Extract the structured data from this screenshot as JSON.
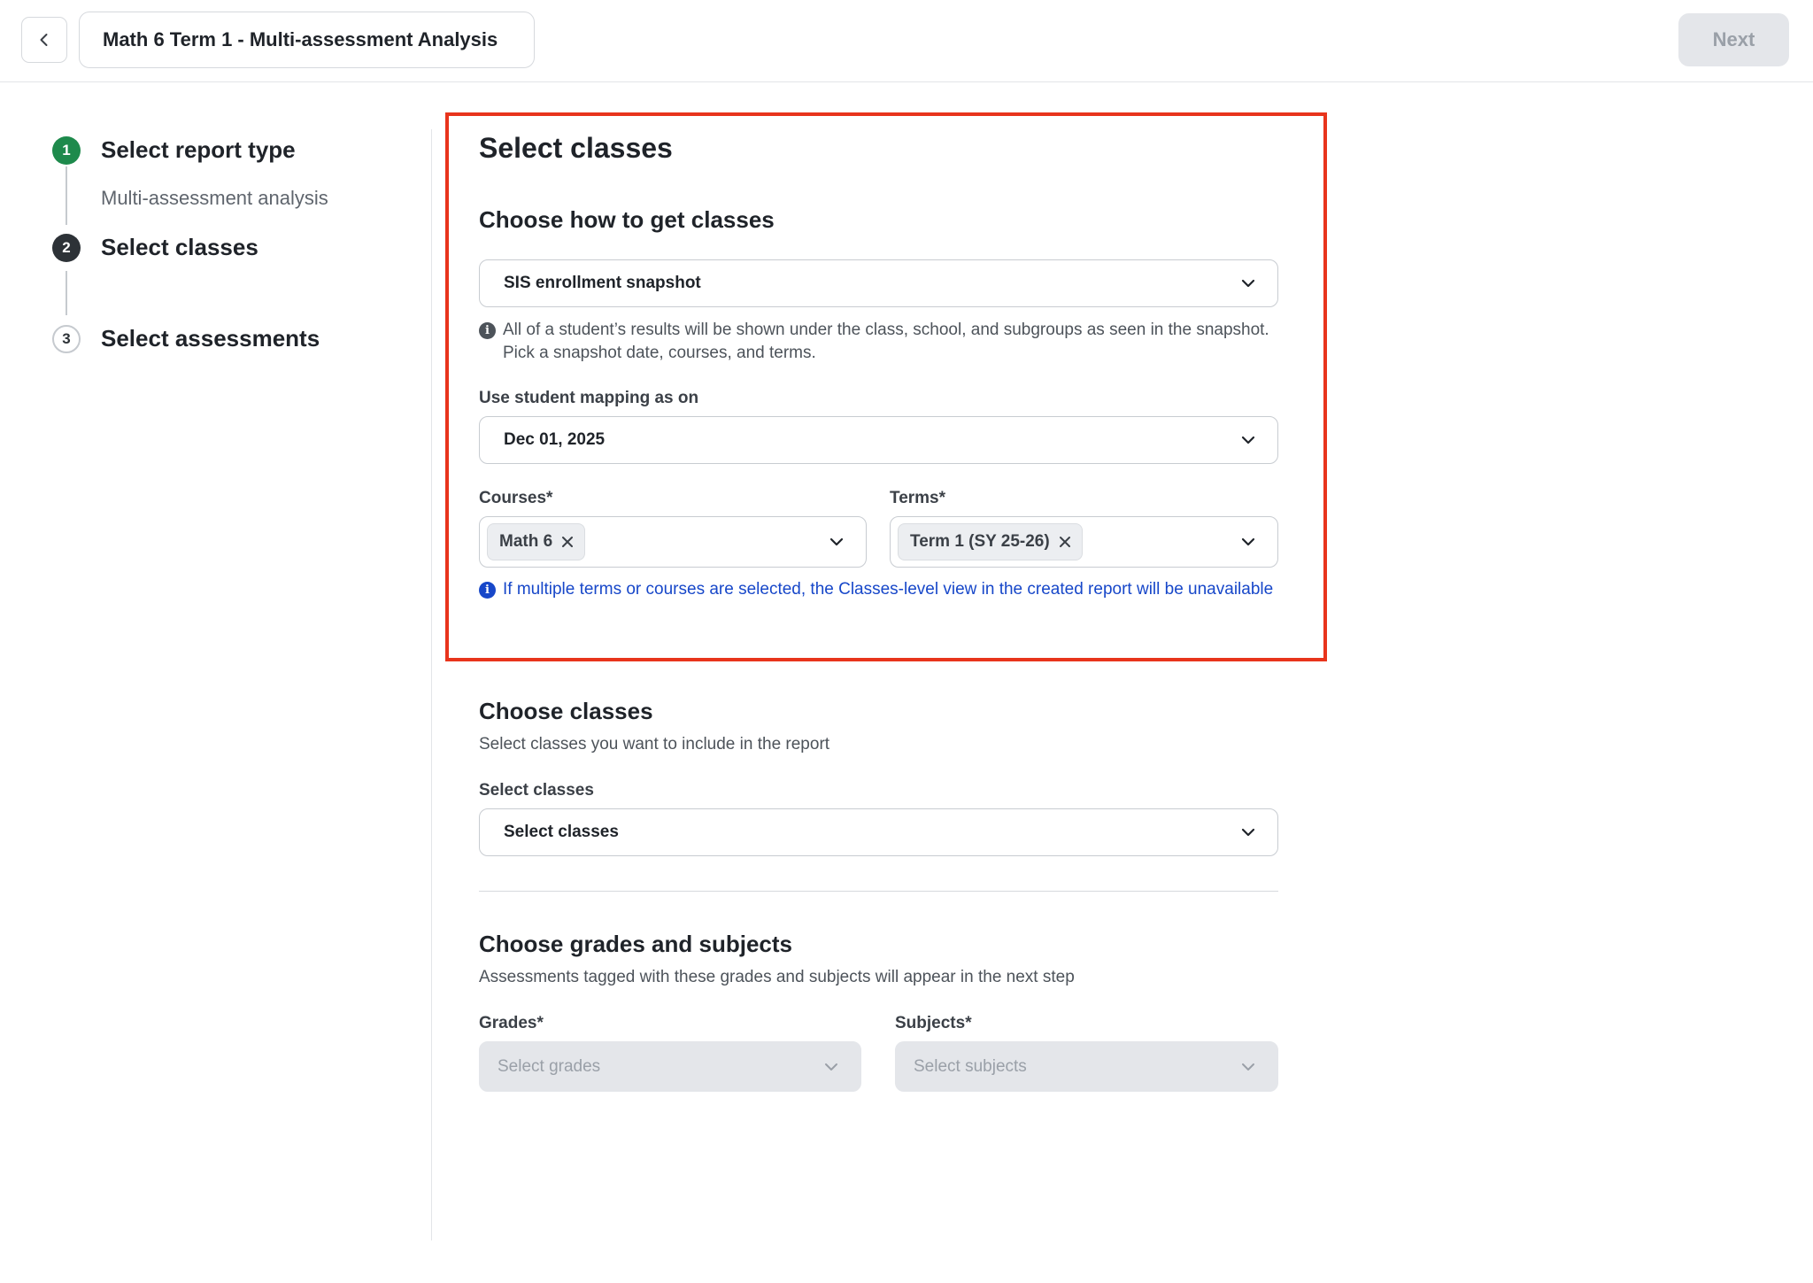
{
  "header": {
    "title": "Math 6 Term 1 - Multi-assessment Analysis",
    "next_label": "Next"
  },
  "stepper": {
    "steps": [
      {
        "number": "1",
        "label": "Select report type",
        "sublabel": "Multi-assessment analysis",
        "status": "done"
      },
      {
        "number": "2",
        "label": "Select classes",
        "sublabel": "",
        "status": "active"
      },
      {
        "number": "3",
        "label": "Select assessments",
        "sublabel": "",
        "status": "todo"
      }
    ]
  },
  "select_classes": {
    "title": "Select classes",
    "how_title": "Choose how to get classes",
    "source_value": "SIS enrollment snapshot",
    "source_info": "All of a student’s results will be shown under the class, school, and subgroups as seen in the snapshot. Pick a snapshot date, courses, and terms.",
    "mapping_label": "Use student mapping as on",
    "mapping_value": "Dec 01, 2025",
    "courses_label": "Courses*",
    "courses_chips": [
      "Math 6"
    ],
    "terms_label": "Terms*",
    "terms_chips": [
      "Term 1 (SY 25-26)"
    ],
    "multi_warning": "If multiple terms or courses are selected, the Classes-level view in the created report will be unavailable"
  },
  "choose_classes": {
    "title": "Choose classes",
    "description": "Select classes you want to include in the report",
    "field_label": "Select classes",
    "field_value": "Select classes"
  },
  "grades_subjects": {
    "title": "Choose grades and subjects",
    "description": "Assessments tagged with these grades and subjects will appear in the next step",
    "grades_label": "Grades*",
    "grades_placeholder": "Select grades",
    "subjects_label": "Subjects*",
    "subjects_placeholder": "Select subjects"
  },
  "colors": {
    "done": "#1e8a4c",
    "active": "#2d3237",
    "highlight": "#e8341c",
    "info_blue": "#1747c9"
  }
}
